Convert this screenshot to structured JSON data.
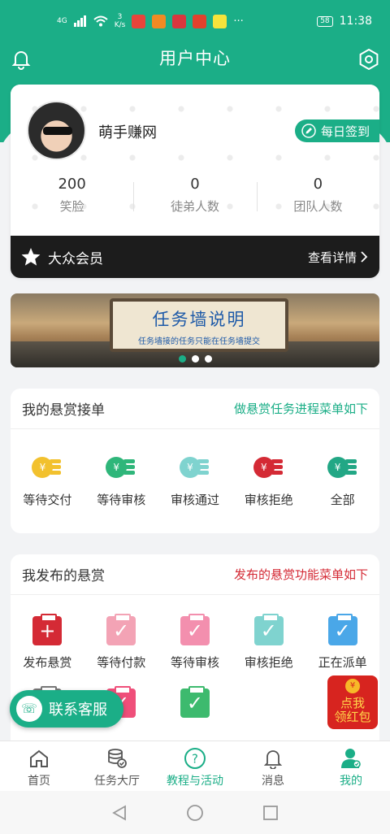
{
  "status_bar": {
    "network": "4G",
    "speed_value": "3",
    "speed_unit": "K/s",
    "more": "···",
    "battery": "58",
    "time": "11:38"
  },
  "header": {
    "title": "用户中心",
    "left_icon": "bell-icon",
    "right_icon": "settings-icon"
  },
  "profile": {
    "username": "萌手赚网",
    "checkin_label": "每日签到",
    "stats": [
      {
        "value": "200",
        "label": "笑脸"
      },
      {
        "value": "0",
        "label": "徒弟人数"
      },
      {
        "value": "0",
        "label": "团队人数"
      }
    ],
    "member_level": "大众会员",
    "member_link": "查看详情"
  },
  "banner": {
    "title": "任务墙说明",
    "subtitle": "任务墙接的任务只能在任务墙提交",
    "dots": 3,
    "active_dot": 1
  },
  "my_orders": {
    "title": "我的悬赏接单",
    "hint": "做悬赏任务进程菜单如下",
    "hint_color": "#1bae87",
    "items": [
      {
        "label": "等待交付",
        "color": "#f2c12e"
      },
      {
        "label": "等待审核",
        "color": "#2fb67a"
      },
      {
        "label": "审核通过",
        "color": "#7fd3cf"
      },
      {
        "label": "审核拒绝",
        "color": "#d42a35"
      },
      {
        "label": "全部",
        "color": "#22a785"
      }
    ]
  },
  "my_posts": {
    "title": "我发布的悬赏",
    "hint": "发布的悬赏功能菜单如下",
    "hint_color": "#d42a35",
    "items": [
      {
        "label": "发布悬赏",
        "color": "#d42a35",
        "glyph": "+"
      },
      {
        "label": "等待付款",
        "color": "#f3a3b5",
        "glyph": "✓"
      },
      {
        "label": "等待审核",
        "color": "#f38fae",
        "glyph": "✓"
      },
      {
        "label": "审核拒绝",
        "color": "#7fd3cf",
        "glyph": "✓"
      },
      {
        "label": "正在派单",
        "color": "#4aa7e8",
        "glyph": "✓"
      }
    ],
    "row2": [
      {
        "color": "#777777",
        "glyph": "✓"
      },
      {
        "color": "#ef4f7a",
        "glyph": "✓"
      },
      {
        "color": "#3dba6e",
        "glyph": "✓"
      }
    ]
  },
  "floating": {
    "contact_label": "联系客服",
    "red_packet_line1": "点我",
    "red_packet_line2": "领红包",
    "red_packet_seal": "¥"
  },
  "tabbar": [
    {
      "label": "首页",
      "icon": "home-icon"
    },
    {
      "label": "任务大厅",
      "icon": "coins-icon"
    },
    {
      "label": "教程与活动",
      "icon": "help-icon",
      "color": "green"
    },
    {
      "label": "消息",
      "icon": "bell-icon"
    },
    {
      "label": "我的",
      "icon": "user-icon",
      "color": "green"
    }
  ]
}
